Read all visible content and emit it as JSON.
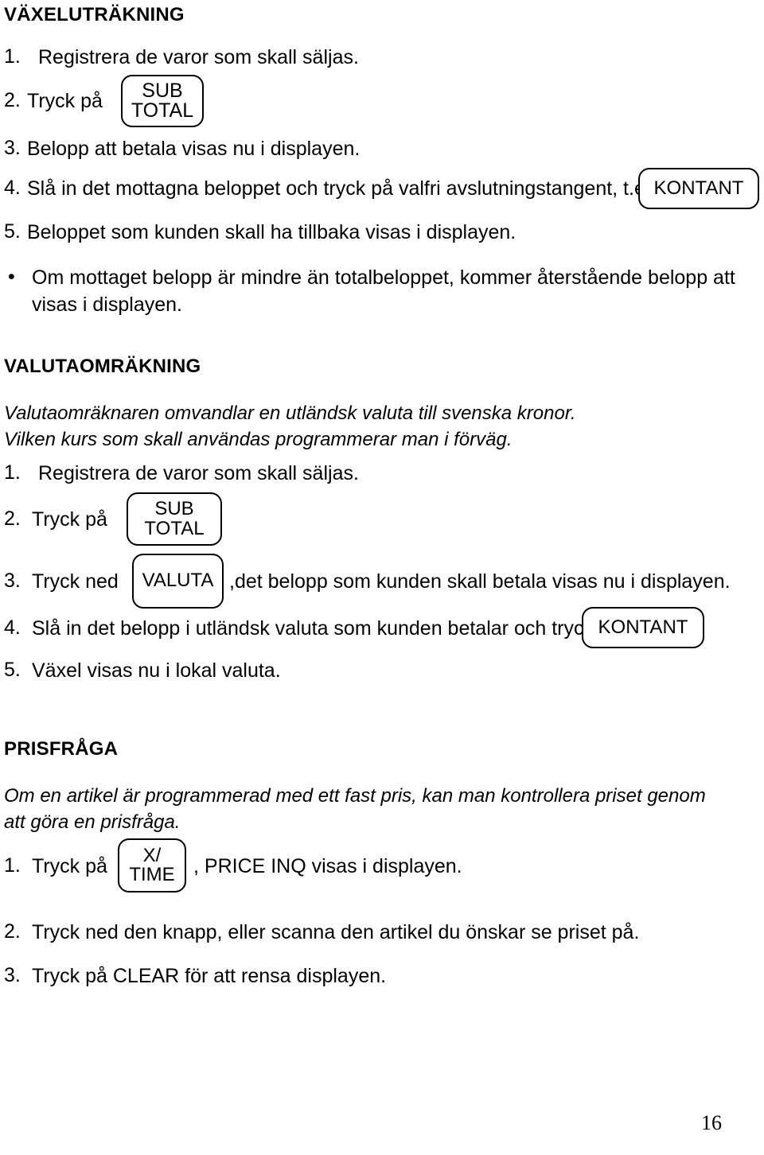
{
  "page": {
    "number": "16"
  },
  "sections": [
    {
      "heading": "VÄXELUTRÄKNING",
      "steps": [
        {
          "num": "1.",
          "text": "Registrera de varor som skall säljas."
        },
        {
          "num": "2.",
          "text": "Tryck på"
        },
        {
          "num": "3.",
          "text": "Belopp att betala visas nu i displayen."
        },
        {
          "num": "4.",
          "text": "Slå in det mottagna beloppet och tryck på valfri avslutningstangent, t.ex."
        },
        {
          "num": "5.",
          "text": "Beloppet som kunden skall ha tillbaka visas i displayen."
        }
      ],
      "bullet": {
        "marker": "•",
        "line1": "Om mottaget belopp är mindre än totalbeloppet, kommer återstående belopp att",
        "line2": "visas i displayen."
      }
    },
    {
      "heading": "VALUTAOMRÄKNING",
      "intro_line1": "Valutaomräknaren omvandlar en utländsk valuta till svenska kronor.",
      "intro_line2": "Vilken kurs som skall användas programmerar man i förväg.",
      "steps": [
        {
          "num": "1.",
          "text": "Registrera de varor som skall säljas."
        },
        {
          "num": "2.",
          "text": "Tryck på"
        },
        {
          "num": "3.",
          "text": "Tryck ned",
          "after": ",det belopp som kunden skall betala visas nu i displayen."
        },
        {
          "num": "4.",
          "text": "Slå in det belopp i utländsk valuta som kunden betalar och tryck"
        },
        {
          "num": "5.",
          "text": "Växel visas nu i lokal valuta."
        }
      ]
    },
    {
      "heading": "PRISFRÅGA",
      "intro_line1": "Om en artikel är programmerad med ett fast pris, kan man kontrollera priset genom",
      "intro_line2": "att göra en prisfråga.",
      "steps": [
        {
          "num": "1.",
          "text": "Tryck på",
          "after": ", PRICE INQ visas i displayen."
        },
        {
          "num": "2.",
          "text": "Tryck ned den knapp, eller scanna den artikel du önskar se priset på."
        },
        {
          "num": "3.",
          "text": "Tryck på CLEAR för att rensa displayen."
        }
      ]
    }
  ],
  "keys": {
    "subtotal_1": {
      "line1": "SUB",
      "line2": "TOTAL"
    },
    "kontant_1": {
      "line1": "KONTANT"
    },
    "subtotal_2": {
      "line1": "SUB",
      "line2": "TOTAL"
    },
    "valuta": {
      "line1": "VALUTA"
    },
    "kontant_2": {
      "line1": "KONTANT"
    },
    "xtime": {
      "line1": "X/",
      "line2": "TIME"
    }
  }
}
